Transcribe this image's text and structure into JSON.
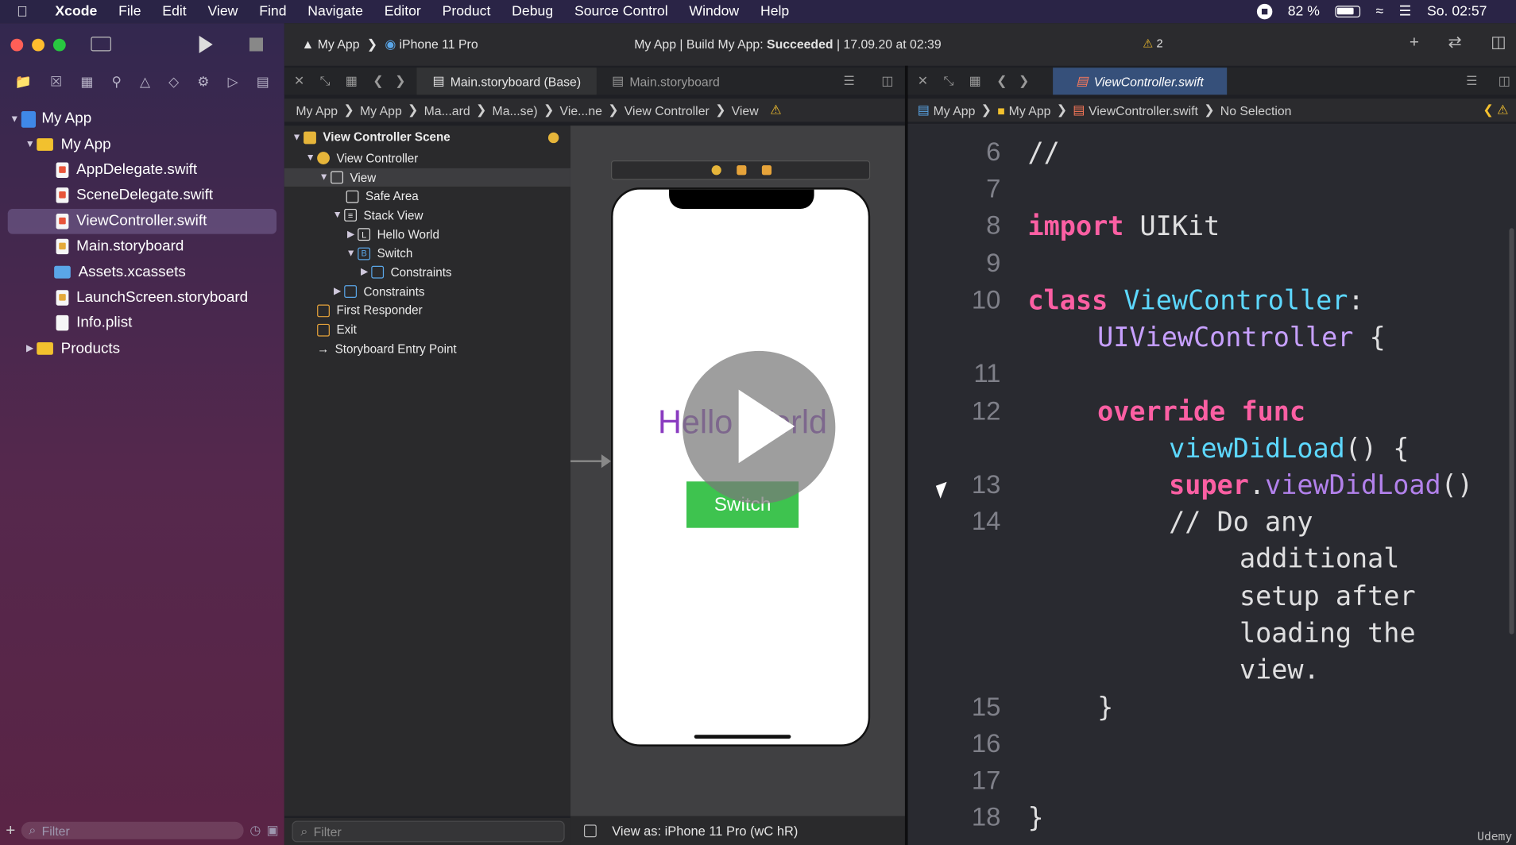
{
  "menubar": {
    "app": "Xcode",
    "items": [
      "File",
      "Edit",
      "View",
      "Find",
      "Navigate",
      "Editor",
      "Product",
      "Debug",
      "Source Control",
      "Window",
      "Help"
    ],
    "battery": "82 %",
    "clock": "So. 02:57"
  },
  "toolbar": {
    "scheme": "My App",
    "device": "iPhone 11 Pro",
    "activity_prefix": "My App | Build My App: ",
    "activity_status": "Succeeded",
    "activity_suffix": " | 17.09.20 at 02:39",
    "warning_count": "2"
  },
  "navigator": {
    "items": [
      {
        "label": "My App",
        "kind": "project"
      },
      {
        "label": "My App",
        "kind": "folder"
      },
      {
        "label": "AppDelegate.swift",
        "kind": "swift"
      },
      {
        "label": "SceneDelegate.swift",
        "kind": "swift"
      },
      {
        "label": "ViewController.swift",
        "kind": "swift",
        "selected": true
      },
      {
        "label": "Main.storyboard",
        "kind": "storyboard"
      },
      {
        "label": "Assets.xcassets",
        "kind": "assets"
      },
      {
        "label": "LaunchScreen.storyboard",
        "kind": "storyboard"
      },
      {
        "label": "Info.plist",
        "kind": "plist"
      },
      {
        "label": "Products",
        "kind": "folder"
      }
    ],
    "filter_placeholder": "Filter"
  },
  "editor1": {
    "tabs": [
      "Main.storyboard (Base)",
      "Main.storyboard"
    ],
    "jumpbar": [
      "My App",
      "My App",
      "Ma...ard",
      "Ma...se)",
      "Vie...ne",
      "View Controller",
      "View"
    ],
    "outline": [
      "View Controller Scene",
      "View Controller",
      "View",
      "Safe Area",
      "Stack View",
      "Hello World",
      "Switch",
      "Constraints",
      "Constraints",
      "First Responder",
      "Exit",
      "Storyboard Entry Point"
    ],
    "filter_placeholder": "Filter",
    "canvas_label": "Hello World",
    "canvas_button": "Switch",
    "view_as": "View as: iPhone 11 Pro (wC hR)"
  },
  "editor2": {
    "tab": "ViewController.swift",
    "jumpbar": [
      "My App",
      "My App",
      "ViewController.swift",
      "No Selection"
    ],
    "watermark": "Udemy"
  },
  "colors": {
    "keyword": "#fc5fa3",
    "type": "#5dd8ff",
    "function": "#b281eb",
    "comment": "#7f8c98",
    "switch_green": "#3ec34f",
    "hello_purple": "#8a3bc0"
  }
}
